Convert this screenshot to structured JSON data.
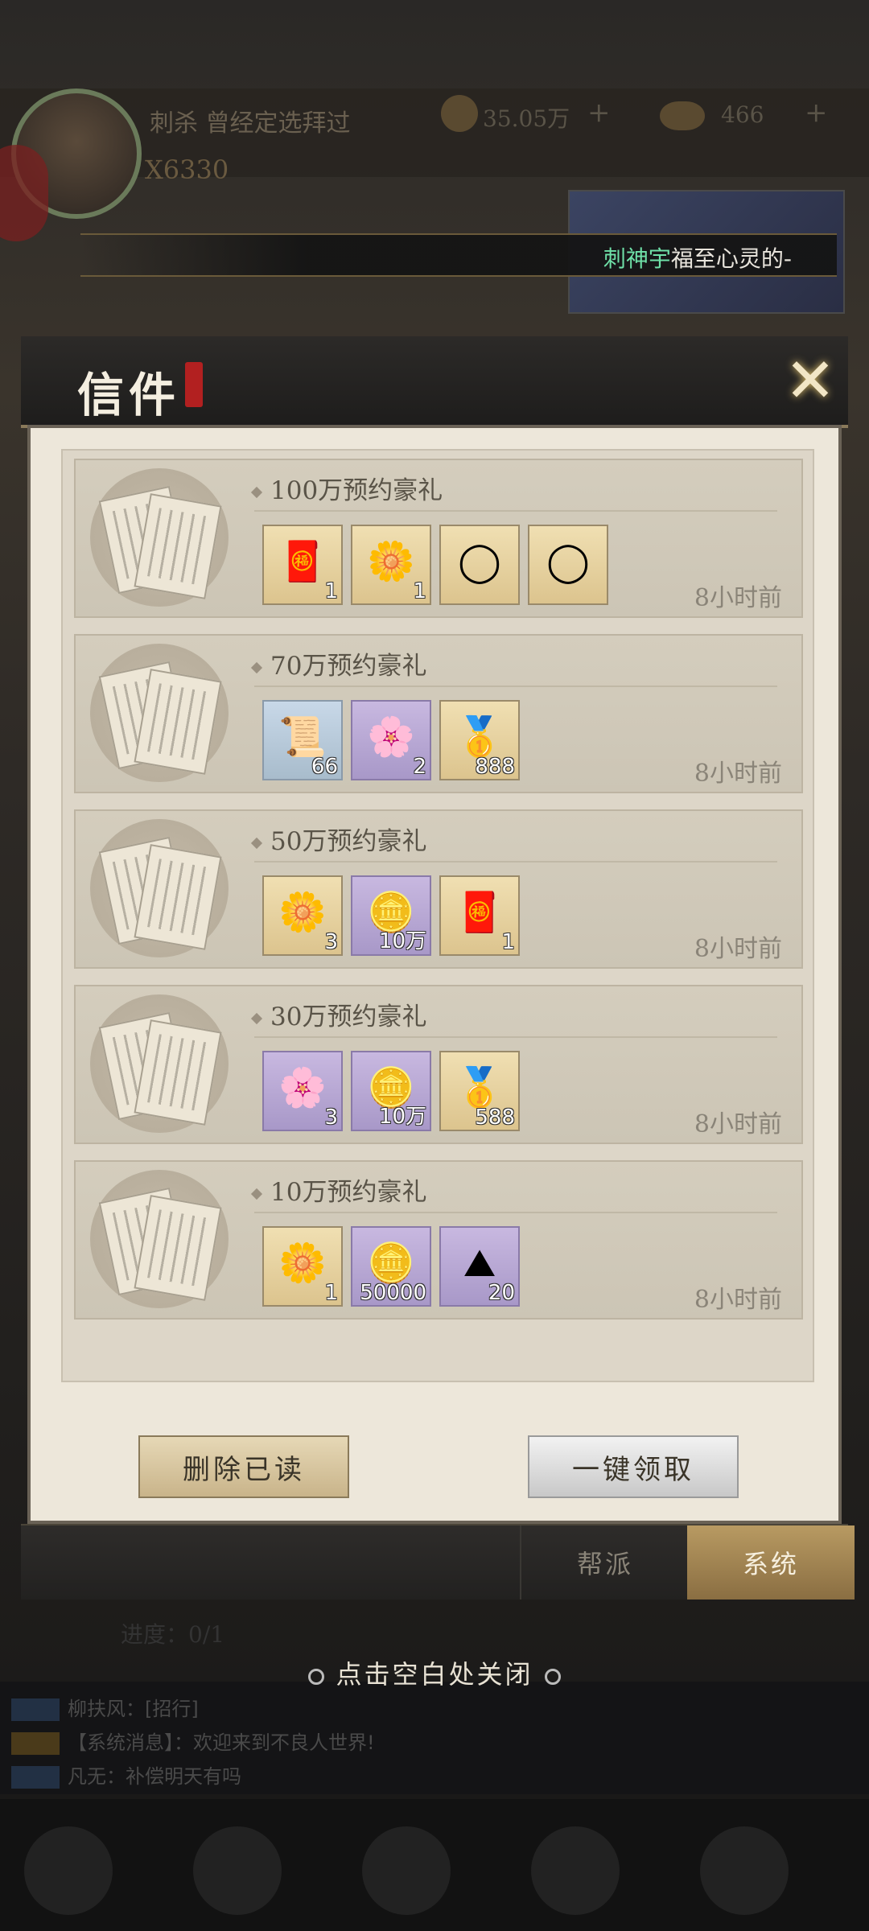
{
  "background": {
    "player_name": "刺杀 曾经定选拜过",
    "power": "X6330",
    "coins": "35.05万",
    "ingots": "466",
    "ticker_player": "刺神宇",
    "ticker_message": "福至心灵的-",
    "task_progress": "进度：0/1",
    "chat": [
      "柳扶风：[招行]",
      "【系统消息】：欢迎来到不良人世界!",
      "凡无：补偿明天有吗"
    ]
  },
  "modal": {
    "title": "信件",
    "close_icon": "close-icon",
    "mails": [
      {
        "title": "100万预约豪礼",
        "time": "8小时前",
        "items": [
          {
            "icon": "red-ticket-icon",
            "glyph": "🧧",
            "count": "1",
            "style": "gold"
          },
          {
            "icon": "gold-flower-icon",
            "glyph": "🌼",
            "count": "1",
            "style": "gold"
          },
          {
            "icon": "red-ring-frame-icon",
            "glyph": "◯",
            "count": "",
            "style": "gold"
          },
          {
            "icon": "jade-ring-frame-icon",
            "glyph": "◯",
            "count": "",
            "style": "gold"
          }
        ]
      },
      {
        "title": "70万预约豪礼",
        "time": "8小时前",
        "items": [
          {
            "icon": "scroll-bag-icon",
            "glyph": "📜",
            "count": "66",
            "style": "blue"
          },
          {
            "icon": "purple-flower-icon",
            "glyph": "🌸",
            "count": "2",
            "style": "purple"
          },
          {
            "icon": "gold-ingot-icon",
            "glyph": "🥇",
            "count": "888",
            "style": "gold"
          }
        ]
      },
      {
        "title": "50万预约豪礼",
        "time": "8小时前",
        "items": [
          {
            "icon": "gold-flower-icon",
            "glyph": "🌼",
            "count": "3",
            "style": "gold"
          },
          {
            "icon": "copper-coin-icon",
            "glyph": "🪙",
            "count": "10万",
            "style": "purple"
          },
          {
            "icon": "red-ticket-icon",
            "glyph": "🧧",
            "count": "1",
            "style": "gold"
          }
        ]
      },
      {
        "title": "30万预约豪礼",
        "time": "8小时前",
        "items": [
          {
            "icon": "purple-flower-icon",
            "glyph": "🌸",
            "count": "3",
            "style": "purple"
          },
          {
            "icon": "copper-coin-icon",
            "glyph": "🪙",
            "count": "10万",
            "style": "purple"
          },
          {
            "icon": "gold-ingot-icon",
            "glyph": "🥇",
            "count": "588",
            "style": "gold"
          }
        ]
      },
      {
        "title": "10万预约豪礼",
        "time": "8小时前",
        "items": [
          {
            "icon": "gold-flower-icon",
            "glyph": "🌼",
            "count": "1",
            "style": "gold"
          },
          {
            "icon": "copper-coin-icon",
            "glyph": "🪙",
            "count": "50000",
            "style": "purple"
          },
          {
            "icon": "ore-stone-icon",
            "glyph": "⛰",
            "count": "20",
            "style": "purple"
          }
        ]
      }
    ],
    "delete_read_label": "删除已读",
    "claim_all_label": "一键领取",
    "tabs": [
      {
        "label": "帮派",
        "active": false
      },
      {
        "label": "系统",
        "active": true
      }
    ]
  },
  "close_hint": "点击空白处关闭",
  "colors": {
    "accent_gold": "#b89a62",
    "ticker_name": "#6fe0a8",
    "panel_bg": "#ede7da"
  }
}
